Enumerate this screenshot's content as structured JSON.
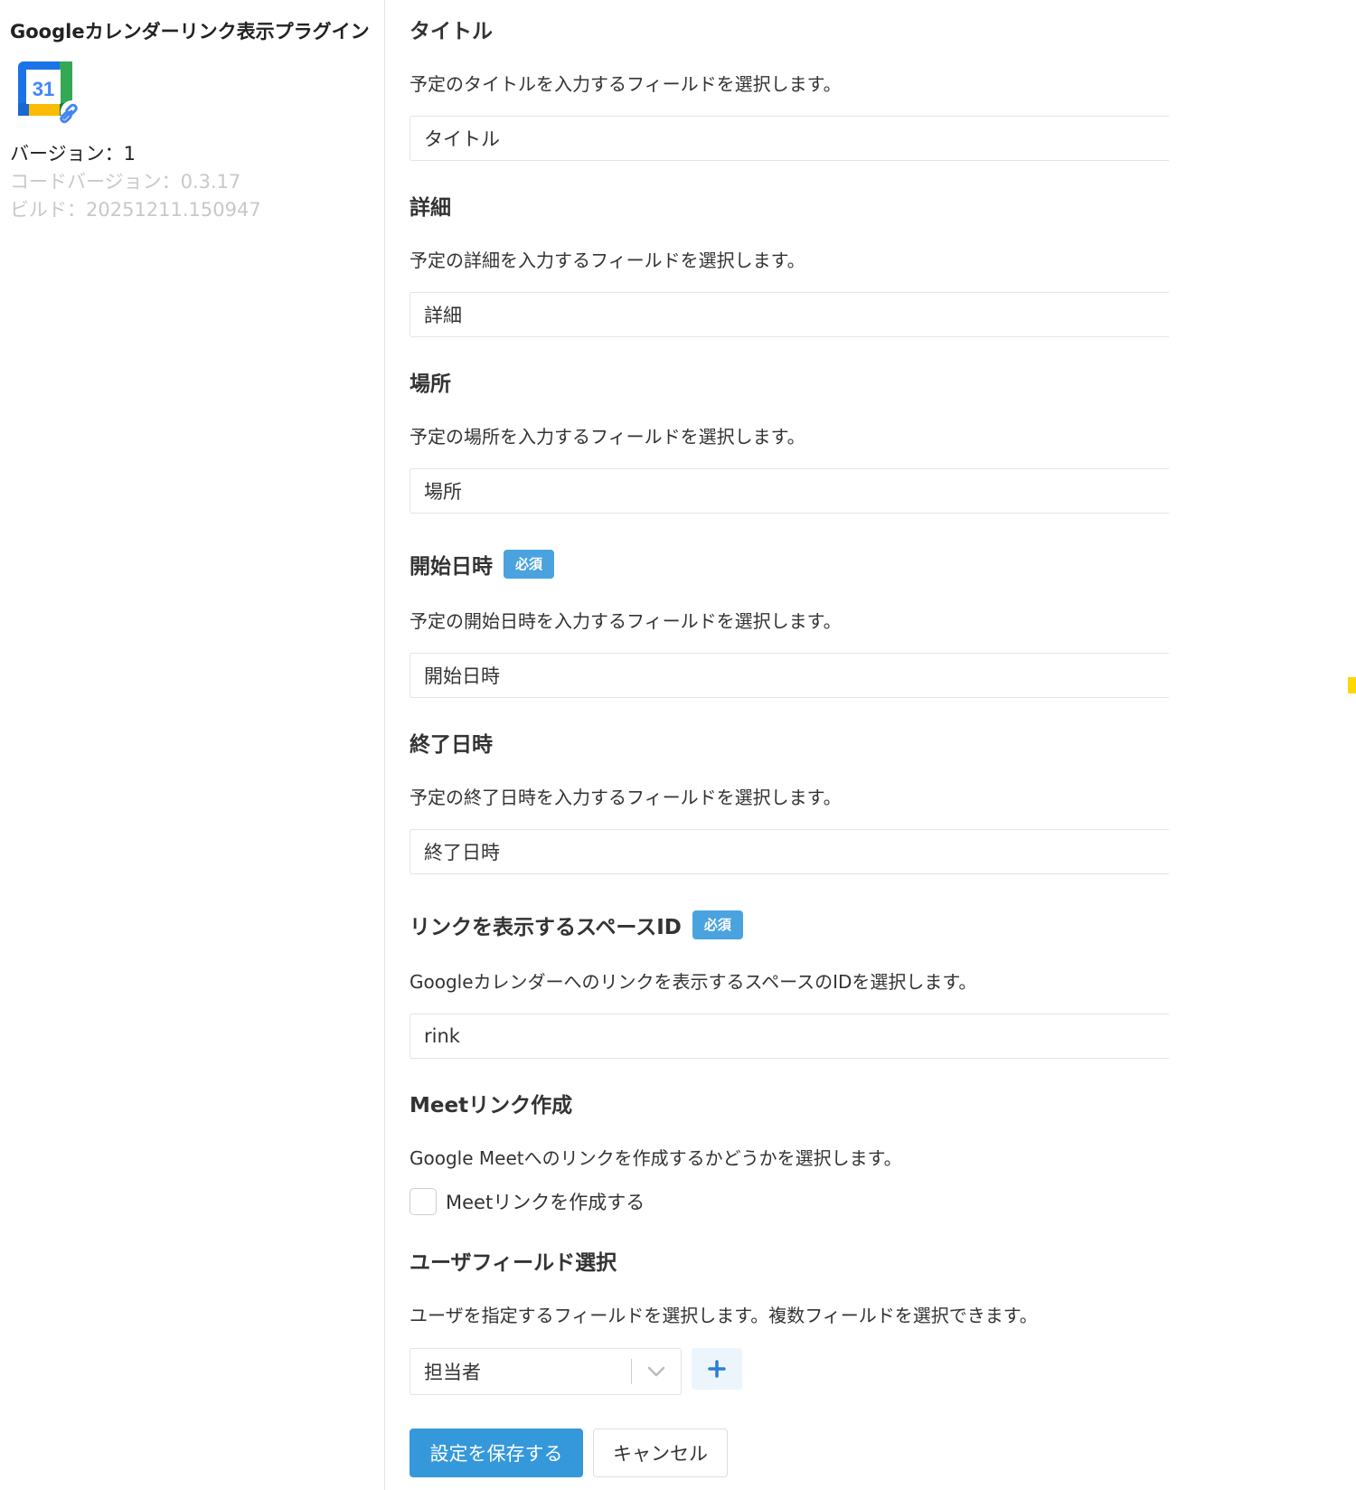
{
  "sidebar": {
    "plugin_title": "Googleカレンダーリンク表示プラグイン",
    "icon_day": "31",
    "version": "バージョン：1",
    "code_version": "コードバージョン：0.3.17",
    "build": "ビルド：20251211.150947"
  },
  "fields": {
    "title": {
      "heading": "タイトル",
      "description": "予定のタイトルを入力するフィールドを選択します。",
      "value": "タイトル"
    },
    "detail": {
      "heading": "詳細",
      "description": "予定の詳細を入力するフィールドを選択します。",
      "value": "詳細"
    },
    "location": {
      "heading": "場所",
      "description": "予定の場所を入力するフィールドを選択します。",
      "value": "場所"
    },
    "start": {
      "heading": "開始日時",
      "required_badge": "必須",
      "description": "予定の開始日時を入力するフィールドを選択します。",
      "value": "開始日時"
    },
    "end": {
      "heading": "終了日時",
      "description": "予定の終了日時を入力するフィールドを選択します。",
      "value": "終了日時"
    },
    "space_id": {
      "heading": "リンクを表示するスペースID",
      "required_badge": "必須",
      "description": "Googleカレンダーへのリンクを表示するスペースのIDを選択します。",
      "value": "rink"
    },
    "meet": {
      "heading": "Meetリンク作成",
      "description": "Google Meetへのリンクを作成するかどうかを選択します。",
      "checkbox_label": "Meetリンクを作成する",
      "checked": false
    },
    "user_fields": {
      "heading": "ユーザフィールド選択",
      "description": "ユーザを指定するフィールドを選択します。複数フィールドを選択できます。",
      "selected": "担当者"
    }
  },
  "actions": {
    "save_label": "設定を保存する",
    "cancel_label": "キャンセル"
  },
  "colors": {
    "primary_button": "#3498db",
    "required_badge": "#4aa3df",
    "add_button_bg": "#edf5fc",
    "muted_text": "#c8c8c8",
    "edge_marker": "#ffd700"
  },
  "icons": {
    "plugin": "google-calendar-link-icon",
    "chevron": "chevron-down-icon",
    "add": "plus-icon"
  }
}
